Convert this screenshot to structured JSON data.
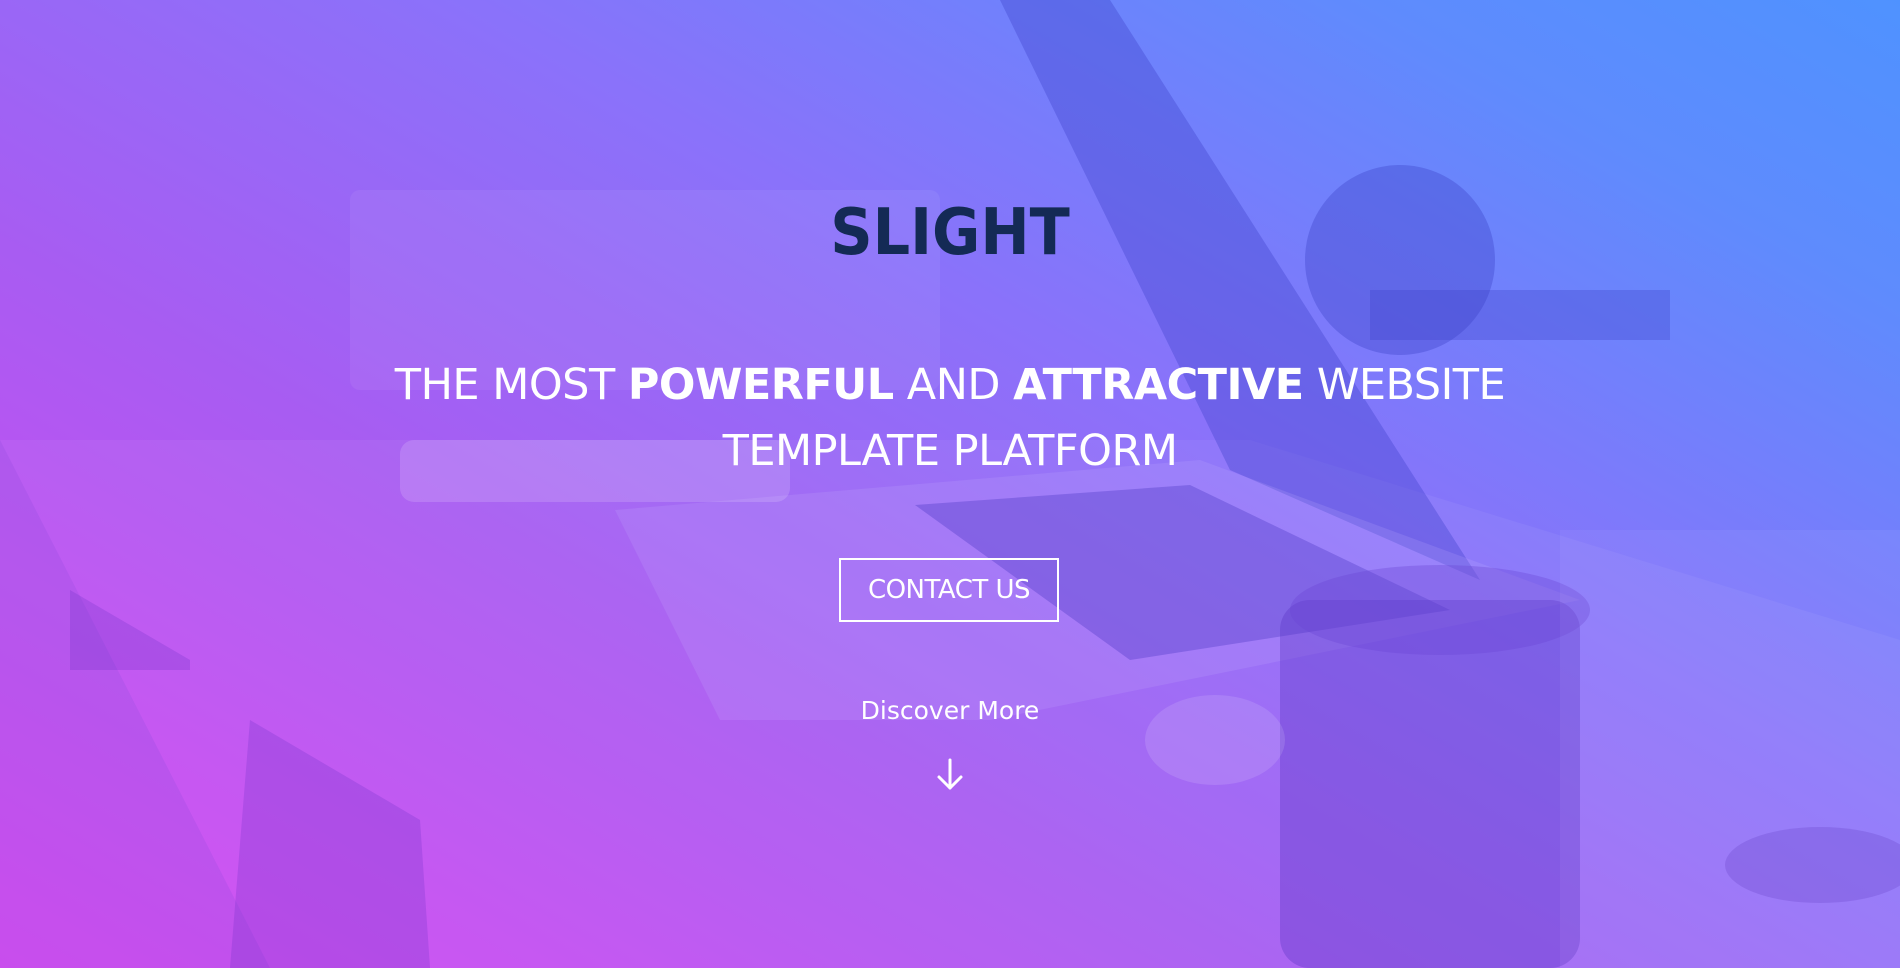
{
  "hero": {
    "brand": "SLIGHT",
    "headline": {
      "part1": "THE MOST ",
      "bold1": "POWERFUL",
      "part2": " AND ",
      "bold2": "ATTRACTIVE",
      "part3": " WEBSITE TEMPLATE PLATFORM"
    },
    "cta_label": "CONTACT US",
    "discover_label": "Discover More",
    "arrow_icon": "arrow-down-icon"
  },
  "colors": {
    "gradient_start": "#d846f2",
    "gradient_end": "#4f92ff",
    "brand_text": "#142a55",
    "text": "#ffffff"
  }
}
